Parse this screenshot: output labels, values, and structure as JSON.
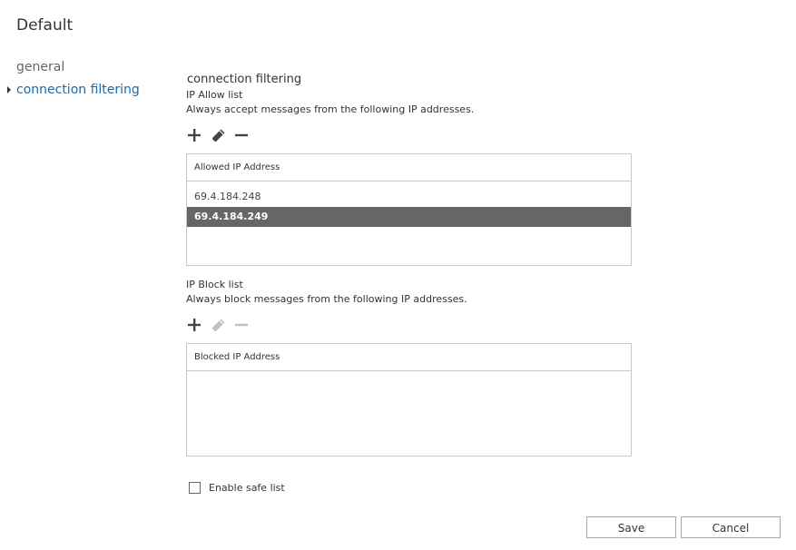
{
  "page": {
    "title": "Default"
  },
  "nav": {
    "items": [
      {
        "label": "general"
      },
      {
        "label": "connection filtering"
      }
    ]
  },
  "content": {
    "heading": "connection filtering",
    "allow_list": {
      "title": "IP Allow list",
      "description": "Always accept messages from the following IP addresses.",
      "column_header": "Allowed IP Address",
      "rows": [
        "69.4.184.248",
        "69.4.184.249"
      ]
    },
    "block_list": {
      "title": "IP Block list",
      "description": "Always block messages from the following IP addresses.",
      "column_header": "Blocked IP Address"
    },
    "safe_list": {
      "label": "Enable safe list"
    }
  },
  "buttons": {
    "save": "Save",
    "cancel": "Cancel"
  },
  "icons": {
    "add": "plus-icon",
    "edit": "pencil-icon",
    "remove": "minus-icon"
  },
  "colors": {
    "nav_active": "#1f6aa5",
    "selected_row": "#666666",
    "icon_enabled": "#444444",
    "icon_disabled": "#c0c0c0"
  }
}
